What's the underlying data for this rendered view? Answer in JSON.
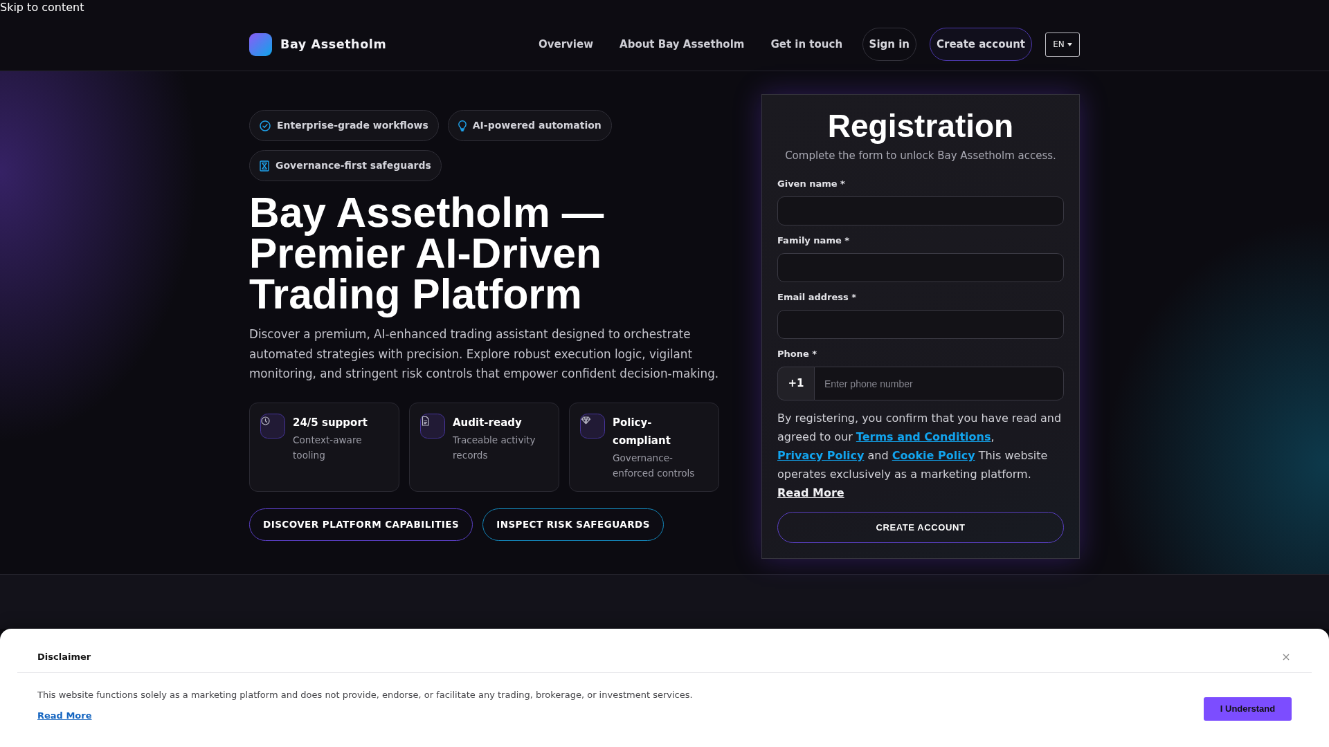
{
  "skip_link": "Skip to content",
  "header": {
    "brand": "Bay Assetholm",
    "nav": [
      {
        "label": "Overview",
        "kind": "link"
      },
      {
        "label": "About Bay Assetholm",
        "kind": "link"
      },
      {
        "label": "Get in touch",
        "kind": "link"
      },
      {
        "label": "Sign in",
        "kind": "pill"
      },
      {
        "label": "Create account",
        "kind": "accent"
      }
    ],
    "language": "EN"
  },
  "hero": {
    "chips": [
      {
        "label": "Enterprise-grade workflows"
      },
      {
        "label": "AI-powered automation"
      },
      {
        "label": "Governance-first safeguards"
      }
    ],
    "title": "Bay Assetholm — Premier AI-Driven Trading Platform",
    "lead": "Discover a premium, AI-enhanced trading assistant designed to orchestrate automated strategies with precision. Explore robust execution logic, vigilant monitoring, and stringent risk controls that empower confident decision-making.",
    "features": [
      {
        "title": "24/5 support",
        "text": "Context-aware tooling"
      },
      {
        "title": "Audit-ready",
        "text": "Traceable activity records"
      },
      {
        "title": "Policy-compliant",
        "text": "Governance-enforced controls"
      }
    ],
    "actions": [
      {
        "label": "DISCOVER PLATFORM CAPABILITIES",
        "kind": "primary"
      },
      {
        "label": "INSPECT RISK SAFEGUARDS",
        "kind": "secondary"
      }
    ]
  },
  "registration": {
    "title": "Registration",
    "subtitle": "Complete the form to unlock Bay Assetholm access.",
    "fields": [
      {
        "label": "Given name *",
        "kind": "text"
      },
      {
        "label": "Family name *",
        "kind": "text"
      },
      {
        "label": "Email address *",
        "kind": "text"
      },
      {
        "label": "Phone *",
        "kind": "phone",
        "prefix": "+1",
        "placeholder": "Enter phone number"
      }
    ],
    "consent": [
      {
        "kind": "text",
        "text": "By registering, you confirm that you have read and agreed to our "
      },
      {
        "kind": "link",
        "text": "Terms and Conditions"
      },
      {
        "kind": "text",
        "text": ", "
      },
      {
        "kind": "link",
        "text": "Privacy Policy"
      },
      {
        "kind": "text",
        "text": " and "
      },
      {
        "kind": "link",
        "text": "Cookie Policy"
      },
      {
        "kind": "text",
        "text": " This website operates exclusively as a marketing platform. "
      },
      {
        "kind": "more",
        "text": "Read More"
      }
    ],
    "submit": "CREATE ACCOUNT"
  },
  "disclaimer": {
    "title": "Disclaimer",
    "text": "This website functions solely as a marketing platform and does not provide, endorse, or facilitate any trading, brokerage, or investment services.",
    "link": "Read More",
    "button": "I Understand"
  }
}
